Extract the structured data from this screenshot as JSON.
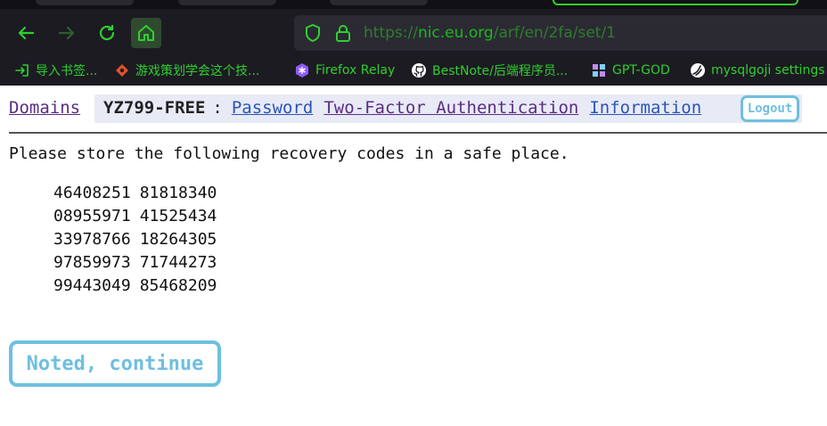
{
  "browser": {
    "url_prefix": "https://",
    "url_host": "nic.eu.org",
    "url_path": "/arf/en/2fa/set/1",
    "accent_color": "#2fd02f",
    "bookmarks": [
      {
        "label": "导入书签...",
        "icon": "import-icon"
      },
      {
        "label": "游戏策划学会这个技...",
        "icon": "game-icon"
      },
      {
        "label": "Firefox Relay",
        "icon": "relay-icon"
      },
      {
        "label": "BestNote/后端程序员...",
        "icon": "github-icon"
      },
      {
        "label": "GPT-GOD",
        "icon": "gpt-icon"
      },
      {
        "label": "mysqlgoji settings",
        "icon": "mysql-icon"
      }
    ]
  },
  "nav": {
    "domains": "Domains",
    "handle": "YZ799-FREE",
    "separator": ":",
    "password": "Password",
    "two_factor": "Two-Factor Authentication",
    "information": "Information",
    "logout": "Logout"
  },
  "content": {
    "intro": "Please store the following recovery codes in a safe place.",
    "codes": [
      [
        "46408251",
        "81818340"
      ],
      [
        "08955971",
        "41525434"
      ],
      [
        "33978766",
        "18264305"
      ],
      [
        "97859973",
        "71744273"
      ],
      [
        "99443049",
        "85468209"
      ]
    ],
    "continue_label": "Noted, continue",
    "button_color": "#6fbfe0"
  }
}
